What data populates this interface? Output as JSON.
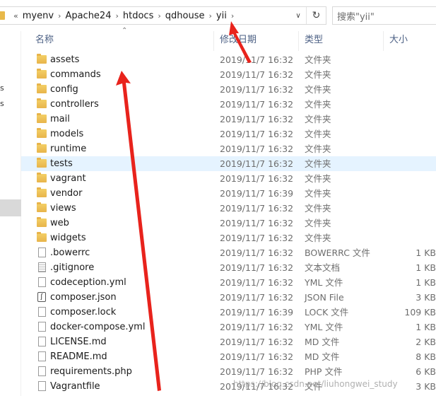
{
  "breadcrumb": {
    "overflow": "«",
    "items": [
      "myenv",
      "Apache24",
      "htdocs",
      "qdhouse",
      "yii"
    ]
  },
  "search": {
    "placeholder": "搜索\"yii\""
  },
  "nav_fragments": [
    "s",
    "s"
  ],
  "columns": {
    "name": "名称",
    "date": "修改日期",
    "type": "类型",
    "size": "大小"
  },
  "files": [
    {
      "name": "assets",
      "date": "2019/11/7 16:32",
      "type": "文件夹",
      "size": "",
      "icon": "folder-icon"
    },
    {
      "name": "commands",
      "date": "2019/11/7 16:32",
      "type": "文件夹",
      "size": "",
      "icon": "folder-icon"
    },
    {
      "name": "config",
      "date": "2019/11/7 16:32",
      "type": "文件夹",
      "size": "",
      "icon": "folder-icon"
    },
    {
      "name": "controllers",
      "date": "2019/11/7 16:32",
      "type": "文件夹",
      "size": "",
      "icon": "folder-icon"
    },
    {
      "name": "mail",
      "date": "2019/11/7 16:32",
      "type": "文件夹",
      "size": "",
      "icon": "folder-icon"
    },
    {
      "name": "models",
      "date": "2019/11/7 16:32",
      "type": "文件夹",
      "size": "",
      "icon": "folder-icon"
    },
    {
      "name": "runtime",
      "date": "2019/11/7 16:32",
      "type": "文件夹",
      "size": "",
      "icon": "folder-icon"
    },
    {
      "name": "tests",
      "date": "2019/11/7 16:32",
      "type": "文件夹",
      "size": "",
      "icon": "folder-icon",
      "highlighted": true
    },
    {
      "name": "vagrant",
      "date": "2019/11/7 16:32",
      "type": "文件夹",
      "size": "",
      "icon": "folder-icon"
    },
    {
      "name": "vendor",
      "date": "2019/11/7 16:39",
      "type": "文件夹",
      "size": "",
      "icon": "folder-icon"
    },
    {
      "name": "views",
      "date": "2019/11/7 16:32",
      "type": "文件夹",
      "size": "",
      "icon": "folder-icon"
    },
    {
      "name": "web",
      "date": "2019/11/7 16:32",
      "type": "文件夹",
      "size": "",
      "icon": "folder-icon"
    },
    {
      "name": "widgets",
      "date": "2019/11/7 16:32",
      "type": "文件夹",
      "size": "",
      "icon": "folder-icon"
    },
    {
      "name": ".bowerrc",
      "date": "2019/11/7 16:32",
      "type": "BOWERRC 文件",
      "size": "1 KB",
      "icon": "file-icon"
    },
    {
      "name": ".gitignore",
      "date": "2019/11/7 16:32",
      "type": "文本文档",
      "size": "1 KB",
      "icon": "text-file-icon"
    },
    {
      "name": "codeception.yml",
      "date": "2019/11/7 16:32",
      "type": "YML 文件",
      "size": "1 KB",
      "icon": "file-icon"
    },
    {
      "name": "composer.json",
      "date": "2019/11/7 16:32",
      "type": "JSON File",
      "size": "3 KB",
      "icon": "json-file-icon"
    },
    {
      "name": "composer.lock",
      "date": "2019/11/7 16:39",
      "type": "LOCK 文件",
      "size": "109 KB",
      "icon": "file-icon"
    },
    {
      "name": "docker-compose.yml",
      "date": "2019/11/7 16:32",
      "type": "YML 文件",
      "size": "1 KB",
      "icon": "file-icon"
    },
    {
      "name": "LICENSE.md",
      "date": "2019/11/7 16:32",
      "type": "MD 文件",
      "size": "2 KB",
      "icon": "file-icon"
    },
    {
      "name": "README.md",
      "date": "2019/11/7 16:32",
      "type": "MD 文件",
      "size": "8 KB",
      "icon": "file-icon"
    },
    {
      "name": "requirements.php",
      "date": "2019/11/7 16:32",
      "type": "PHP 文件",
      "size": "6 KB",
      "icon": "file-icon"
    },
    {
      "name": "Vagrantfile",
      "date": "2019/11/7 16:32",
      "type": "文件",
      "size": "3 KB",
      "icon": "file-icon"
    }
  ],
  "watermark": "https://blog.csdn.net/liuhongwei_study",
  "colors": {
    "highlight_row": "#e5f3ff",
    "header_text": "#4d6185",
    "annotation_arrow": "#e8231c",
    "folder": "#e8b44a"
  }
}
